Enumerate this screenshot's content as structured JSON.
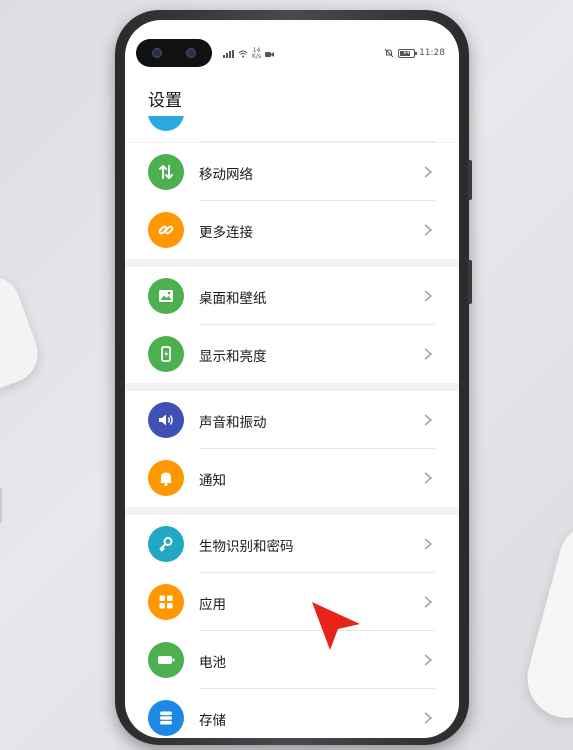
{
  "status_bar": {
    "network_speed_value": "14",
    "network_speed_unit": "K/s",
    "battery_level": "64",
    "time": "11:28"
  },
  "page": {
    "title": "设置"
  },
  "settings_items": [
    {
      "label": "移动网络",
      "icon": "mobile-network-icon",
      "color": "#4caf50"
    },
    {
      "label": "更多连接",
      "icon": "link-icon",
      "color": "#ff9800"
    },
    {
      "label": "桌面和壁纸",
      "icon": "wallpaper-icon",
      "color": "#4caf50"
    },
    {
      "label": "显示和亮度",
      "icon": "display-icon",
      "color": "#4caf50"
    },
    {
      "label": "声音和振动",
      "icon": "volume-icon",
      "color": "#3f51b5"
    },
    {
      "label": "通知",
      "icon": "bell-icon",
      "color": "#ff9800"
    },
    {
      "label": "生物识别和密码",
      "icon": "key-icon",
      "color": "#1fa7c4"
    },
    {
      "label": "应用",
      "icon": "apps-grid-icon",
      "color": "#ff9800"
    },
    {
      "label": "电池",
      "icon": "battery-icon",
      "color": "#4caf50"
    },
    {
      "label": "存储",
      "icon": "storage-icon",
      "color": "#1e88e5"
    }
  ],
  "colors": {
    "cursor": "#e8231a",
    "partial_item_icon": "#29a9e0"
  }
}
